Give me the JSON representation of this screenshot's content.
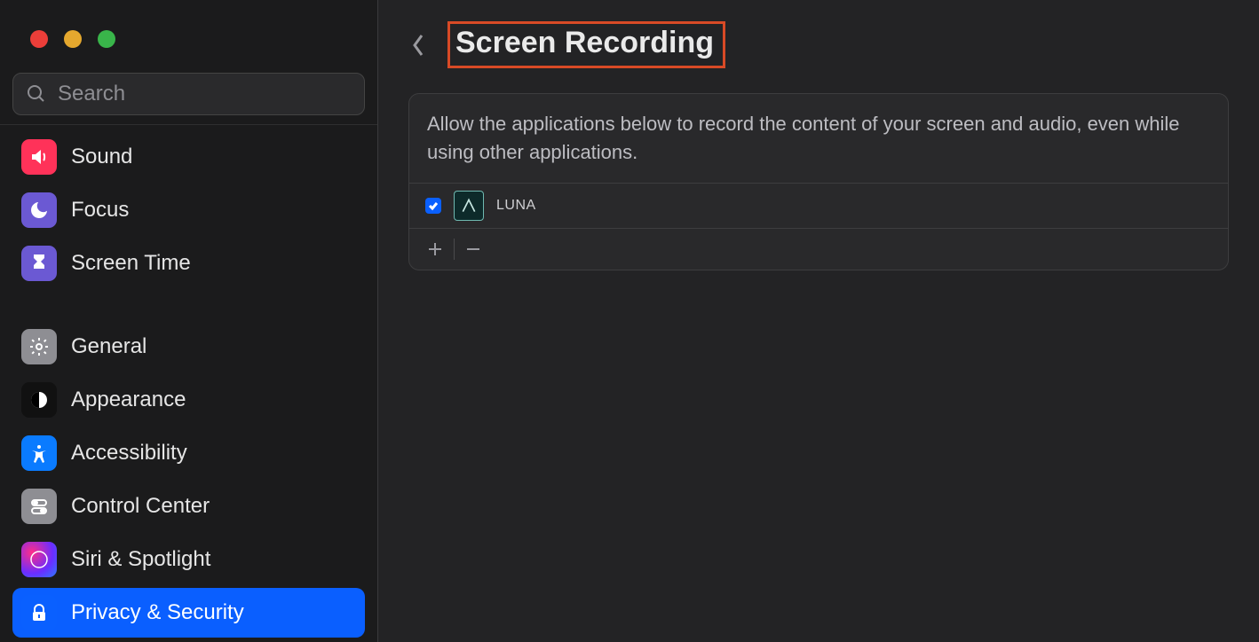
{
  "search": {
    "placeholder": "Search"
  },
  "sidebar": {
    "items": [
      {
        "label": "Sound"
      },
      {
        "label": "Focus"
      },
      {
        "label": "Screen Time"
      },
      {
        "label": "General"
      },
      {
        "label": "Appearance"
      },
      {
        "label": "Accessibility"
      },
      {
        "label": "Control Center"
      },
      {
        "label": "Siri & Spotlight"
      },
      {
        "label": "Privacy & Security"
      }
    ]
  },
  "page": {
    "title": "Screen Recording",
    "description": "Allow the applications below to record the content of your screen and audio, even while using other applications."
  },
  "apps": [
    {
      "name": "LUNA",
      "checked": true
    }
  ]
}
